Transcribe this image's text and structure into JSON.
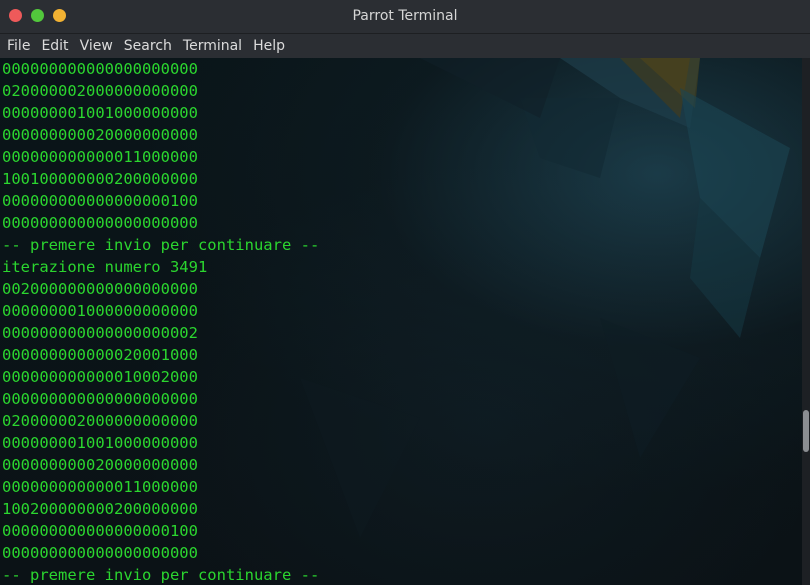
{
  "window": {
    "title": "Parrot Terminal"
  },
  "menu": [
    "File",
    "Edit",
    "View",
    "Search",
    "Terminal",
    "Help"
  ],
  "terminal_lines": [
    "000000000000000000000",
    "020000002000000000000",
    "000000001001000000000",
    "000000000020000000000",
    "000000000000011000000",
    "100100000000200000000",
    "000000000000000000100",
    "000000000000000000000",
    "-- premere invio per continuare --",
    "iterazione numero 3491",
    "002000000000000000000",
    "000000001000000000000",
    "000000000000000000002",
    "000000000000020001000",
    "000000000000010002000",
    "000000000000000000000",
    "020000002000000000000",
    "000000001001000000000",
    "000000000020000000000",
    "000000000000011000000",
    "100200000000200000000",
    "000000000000000000100",
    "000000000000000000000",
    "-- premere invio per continuare --"
  ],
  "colors": {
    "terminal_text": "#2bd62f",
    "titlebar": "#2b2e33",
    "close": "#ee5a5a",
    "maximize": "#52c83c",
    "minimize": "#f2b233"
  }
}
